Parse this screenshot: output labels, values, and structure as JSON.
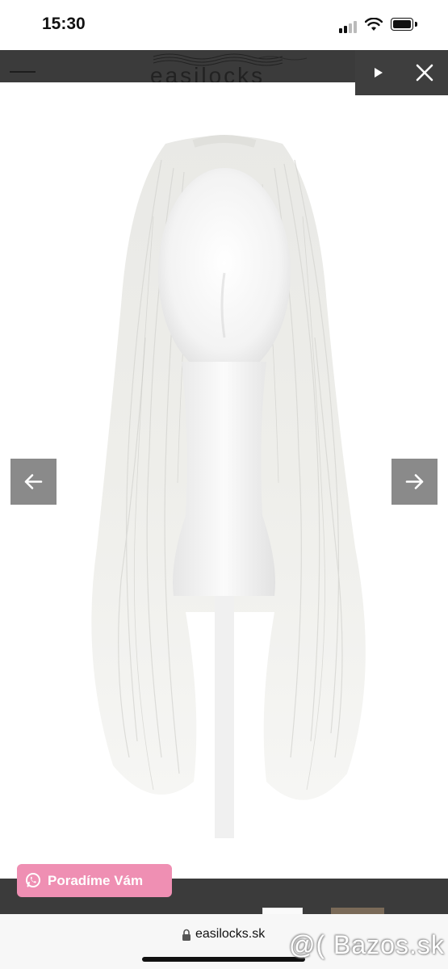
{
  "status_bar": {
    "time": "15:30",
    "signal_icon": "cellular-signal-icon",
    "wifi_icon": "wifi-icon",
    "battery_icon": "battery-icon"
  },
  "site_header": {
    "logo": "easilocks",
    "menu_icon": "hamburger-menu-icon",
    "cart_icon": "cart-icon"
  },
  "lightbox": {
    "play_icon": "play-icon",
    "close_icon": "close-icon",
    "prev_icon": "arrow-left-icon",
    "next_icon": "arrow-right-icon"
  },
  "chat": {
    "label": "Poradíme Vám",
    "icon": "whatsapp-icon",
    "color": "#ef8fb3"
  },
  "browser": {
    "url": "easilocks.sk",
    "lock_icon": "lock-icon"
  },
  "watermark": "@( Bazos.sk",
  "colors": {
    "header_bg": "#3b3b3b",
    "arrow_bg": "#8a8a8a",
    "help_button": "#ef8fb3"
  }
}
